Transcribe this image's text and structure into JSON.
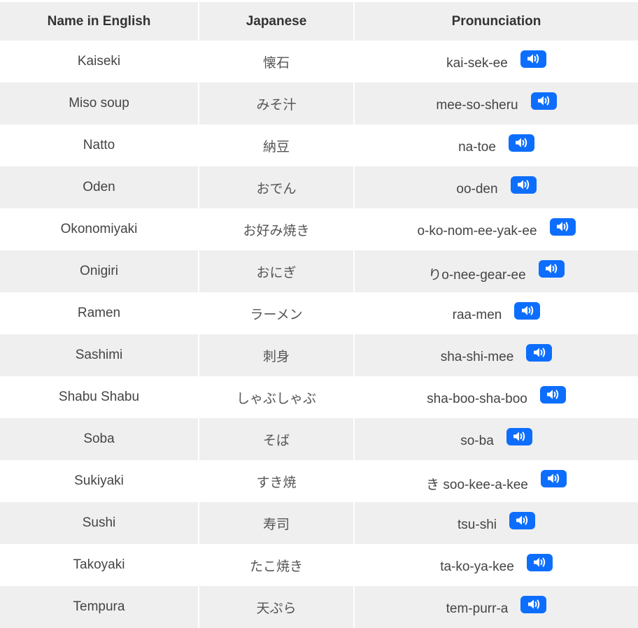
{
  "table": {
    "headers": [
      "Name in English",
      "Japanese",
      "Pronunciation"
    ],
    "audio_icon": "speaker-volume-icon",
    "accent_color": "#0d6efd",
    "rows": [
      {
        "english": "Kaiseki",
        "japanese": "懐石",
        "pronunciation": "kai-sek-ee"
      },
      {
        "english": "Miso soup",
        "japanese": "みそ汁",
        "pronunciation": "mee-so-sheru"
      },
      {
        "english": "Natto",
        "japanese": "納豆",
        "pronunciation": "na-toe"
      },
      {
        "english": "Oden",
        "japanese": "おでん",
        "pronunciation": "oo-den"
      },
      {
        "english": "Okonomiyaki",
        "japanese": "お好み焼き",
        "pronunciation": "o-ko-nom-ee-yak-ee"
      },
      {
        "english": "Onigiri",
        "japanese": "おにぎ",
        "pronunciation": "りo-nee-gear-ee"
      },
      {
        "english": "Ramen",
        "japanese": "ラーメン",
        "pronunciation": "raa-men"
      },
      {
        "english": "Sashimi",
        "japanese": "刺身",
        "pronunciation": "sha-shi-mee"
      },
      {
        "english": "Shabu Shabu",
        "japanese": "しゃぶしゃぶ",
        "pronunciation": "sha-boo-sha-boo"
      },
      {
        "english": "Soba",
        "japanese": "そば",
        "pronunciation": "so-ba"
      },
      {
        "english": "Sukiyaki",
        "japanese": "すき焼",
        "pronunciation": "き soo-kee-a-kee"
      },
      {
        "english": "Sushi",
        "japanese": "寿司",
        "pronunciation": "tsu-shi"
      },
      {
        "english": "Takoyaki",
        "japanese": "たこ焼き",
        "pronunciation": "ta-ko-ya-kee"
      },
      {
        "english": "Tempura",
        "japanese": "天ぷら",
        "pronunciation": "tem-purr-a"
      }
    ]
  }
}
